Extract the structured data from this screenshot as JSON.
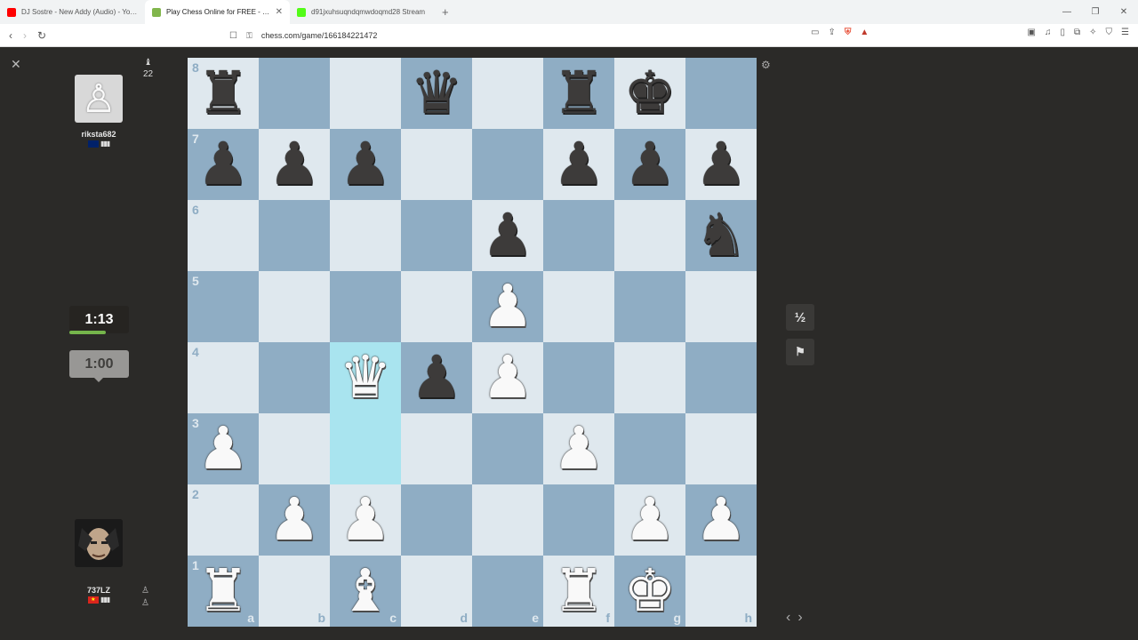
{
  "browser": {
    "tabs": [
      {
        "title": "DJ Sostre - New Addy (Audio) - YouT",
        "color": "#ff0000",
        "active": false
      },
      {
        "title": "Play Chess Online for FREE - 2 P",
        "color": "#81b64c",
        "active": true
      },
      {
        "title": "d91jxuhsuqndqmwdoqmd28 Stream",
        "color": "#53fc18",
        "active": false
      }
    ],
    "new_tab": "+",
    "url": "chess.com/game/166184221472",
    "win": {
      "min": "—",
      "max": "❐",
      "close": "✕"
    }
  },
  "game": {
    "close_label": "✕",
    "top_player": {
      "name": "rikstа682",
      "captured_hint": "♝",
      "captured_count": "22"
    },
    "bottom_player": {
      "name": "737LZ"
    },
    "clock_active": "1:13",
    "clock_idle": "1:00",
    "draw_label": "½",
    "resign_label": "⚑",
    "nav_prev": "‹",
    "nav_next": "›",
    "settings": "⚙",
    "files": [
      "a",
      "b",
      "c",
      "d",
      "e",
      "f",
      "g",
      "h"
    ],
    "ranks": [
      "8",
      "7",
      "6",
      "5",
      "4",
      "3",
      "2",
      "1"
    ],
    "board": [
      [
        "br",
        "",
        "",
        "bq",
        "",
        "br",
        "bk",
        ""
      ],
      [
        "bp",
        "bp",
        "bp",
        "",
        "",
        "bp",
        "bp",
        "bp"
      ],
      [
        "",
        "",
        "",
        "",
        "bp",
        "",
        "",
        "bn"
      ],
      [
        "",
        "",
        "",
        "",
        "wp",
        "",
        "",
        ""
      ],
      [
        "",
        "",
        "wq",
        "bp",
        "wp",
        "",
        "",
        ""
      ],
      [
        "wp",
        "",
        "",
        "",
        "",
        "wp",
        "",
        ""
      ],
      [
        "",
        "wp",
        "wp",
        "",
        "",
        "",
        "wp",
        "wp"
      ],
      [
        "wr",
        "",
        "wb",
        "",
        "",
        "wr",
        "wk",
        ""
      ]
    ],
    "highlighted": [
      "c4",
      "c3"
    ],
    "colors": {
      "light": "#dfe8ee",
      "dark": "#8fadc4",
      "highlight": "#a9e4ef"
    }
  }
}
